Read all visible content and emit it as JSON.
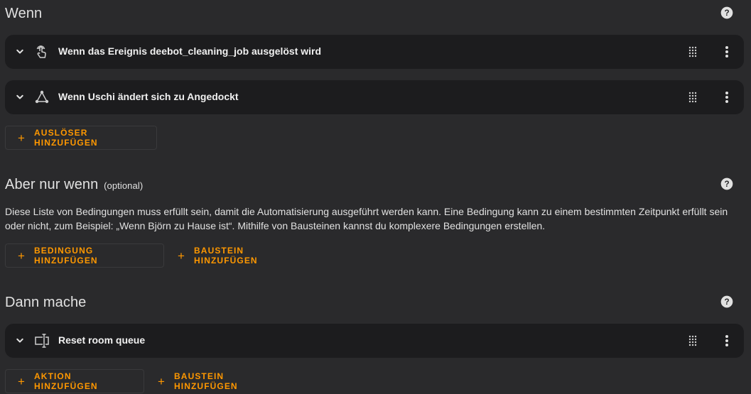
{
  "wenn": {
    "title": "Wenn",
    "triggers": [
      {
        "label": "Wenn das Ereignis deebot_cleaning_job ausgelöst wird",
        "icon": "gesture-tap-icon"
      },
      {
        "label": "Wenn Uschi ändert sich zu Angedockt",
        "icon": "state-graph-icon"
      }
    ],
    "add_trigger_label": "AUSLÖSER HINZUFÜGEN"
  },
  "conditions": {
    "title": "Aber nur wenn",
    "optional": "(optional)",
    "description": "Diese Liste von Bedingungen muss erfüllt sein, damit die Automatisierung ausgeführt werden kann. Eine Bedingung kann zu einem bestimmten Zeitpunkt erfüllt sein oder nicht, zum Beispiel: „Wenn Björn zu Hause ist“. Mithilfe von Bausteinen kannst du komplexere Bedingungen erstellen.",
    "add_condition_label": "BEDINGUNG HINZUFÜGEN",
    "add_block_label": "BAUSTEIN HINZUFÜGEN"
  },
  "actions": {
    "title": "Dann mache",
    "items": [
      {
        "label": "Reset room queue",
        "icon": "form-textbox-icon"
      }
    ],
    "add_action_label": "AKTION HINZUFÜGEN",
    "add_block_label": "BAUSTEIN HINZUFÜGEN"
  },
  "colors": {
    "background": "#2a2a2c",
    "card": "#1c1c1e",
    "accent": "#ff9800",
    "text": "#e1e1e1"
  }
}
